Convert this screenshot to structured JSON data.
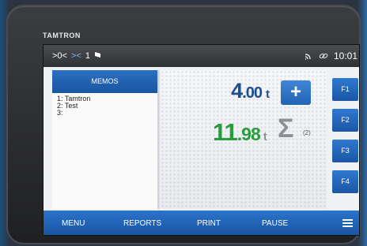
{
  "device": {
    "brand": "TAMTRON"
  },
  "status_bar": {
    "zero_indicator": ">0<",
    "stable_indicator": "><",
    "platform": "1",
    "time": "10:01",
    "icons": [
      "wifi-icon",
      "link-icon"
    ]
  },
  "memos": {
    "title": "MEMOS",
    "items": [
      "1: Tamtron",
      "2: Test",
      "3:"
    ]
  },
  "weighing": {
    "gross_int": "4",
    "gross_dec": ".00",
    "gross_unit": "t",
    "plus_label": "+",
    "total_int": "11",
    "total_dec": ".98",
    "total_unit": "t",
    "sum_symbol": "Σ",
    "sum_count": "(2)"
  },
  "function_keys": [
    "F1",
    "F2",
    "F3",
    "F4"
  ],
  "menu": {
    "items": [
      "MENU",
      "REPORTS",
      "PRINT",
      "PAUSE"
    ]
  },
  "colors": {
    "accent_blue": "#1a56a4",
    "gross_blue": "#1e4f8c",
    "total_green": "#2a9c3f"
  }
}
